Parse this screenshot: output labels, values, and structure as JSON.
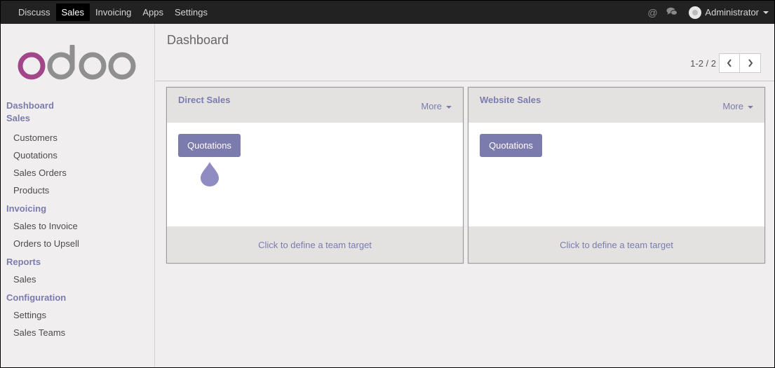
{
  "topnav": {
    "items": [
      "Discuss",
      "Sales",
      "Invoicing",
      "Apps",
      "Settings"
    ],
    "active": "Sales"
  },
  "topbar": {
    "mention_icon": "at-icon",
    "chat_icon": "comments-icon",
    "user": "Administrator"
  },
  "brand": {
    "logo_text": "odoo",
    "accent": "#7c7bad",
    "logo_pink": "#a24689",
    "logo_gray": "#8f8f8f"
  },
  "sidebar": {
    "dashboard": "Dashboard",
    "sales_section": "Sales",
    "sales_items": [
      "Customers",
      "Quotations",
      "Sales Orders",
      "Products"
    ],
    "invoicing_section": "Invoicing",
    "invoicing_items": [
      "Sales to Invoice",
      "Orders to Upsell"
    ],
    "reports_section": "Reports",
    "reports_items": [
      "Sales"
    ],
    "config_section": "Configuration",
    "config_items": [
      "Settings",
      "Sales Teams"
    ]
  },
  "main": {
    "title": "Dashboard",
    "pager": "1-2 / 2"
  },
  "teams": [
    {
      "name": "Direct Sales",
      "more": "More",
      "button": "Quotations",
      "footer": "Click to define a team target"
    },
    {
      "name": "Website Sales",
      "more": "More",
      "button": "Quotations",
      "footer": "Click to define a team target"
    }
  ]
}
